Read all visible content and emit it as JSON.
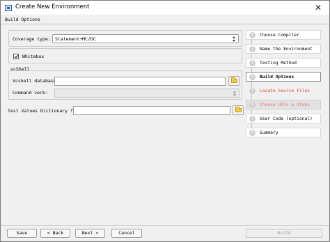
{
  "window": {
    "title": "Create New Environment",
    "close_glyph": "✕"
  },
  "header": {
    "label": "Build Options"
  },
  "form": {
    "coverage_type": {
      "label": "Coverage type:",
      "value": "Statement+MC/DC"
    },
    "whitebox": {
      "label": "Whitebox",
      "checked": true
    },
    "vcshell": {
      "group_label": "vcShell",
      "database_label": "Vcshell database:",
      "database_value": "",
      "command_verb_label": "Command verb:",
      "command_verb_value": ""
    },
    "test_values": {
      "label": "Test Values Dictionary file",
      "value": ""
    }
  },
  "steps": [
    {
      "number": "1",
      "label": "Choose Compiler",
      "state": "done"
    },
    {
      "number": "2",
      "label": "Name the Environment",
      "state": "done"
    },
    {
      "number": "3",
      "label": "Testing Method",
      "state": "done"
    },
    {
      "number": "4",
      "label": "Build Options",
      "state": "current"
    },
    {
      "number": "5",
      "label": "Locate Source Files",
      "state": "pending"
    },
    {
      "number": "6",
      "label": "Choose UUTs & Stubs",
      "state": "disabled"
    },
    {
      "number": "7",
      "label": "User Code (optional)",
      "state": "done"
    },
    {
      "number": "8",
      "label": "Summary",
      "state": "done"
    }
  ],
  "buttons": {
    "save": "Save",
    "back": "< Back",
    "next": "Next >",
    "cancel": "Cancel",
    "build": "Build"
  },
  "colors": {
    "pending_step_text": "#e53935",
    "window_bg": "#f0f0f0"
  }
}
